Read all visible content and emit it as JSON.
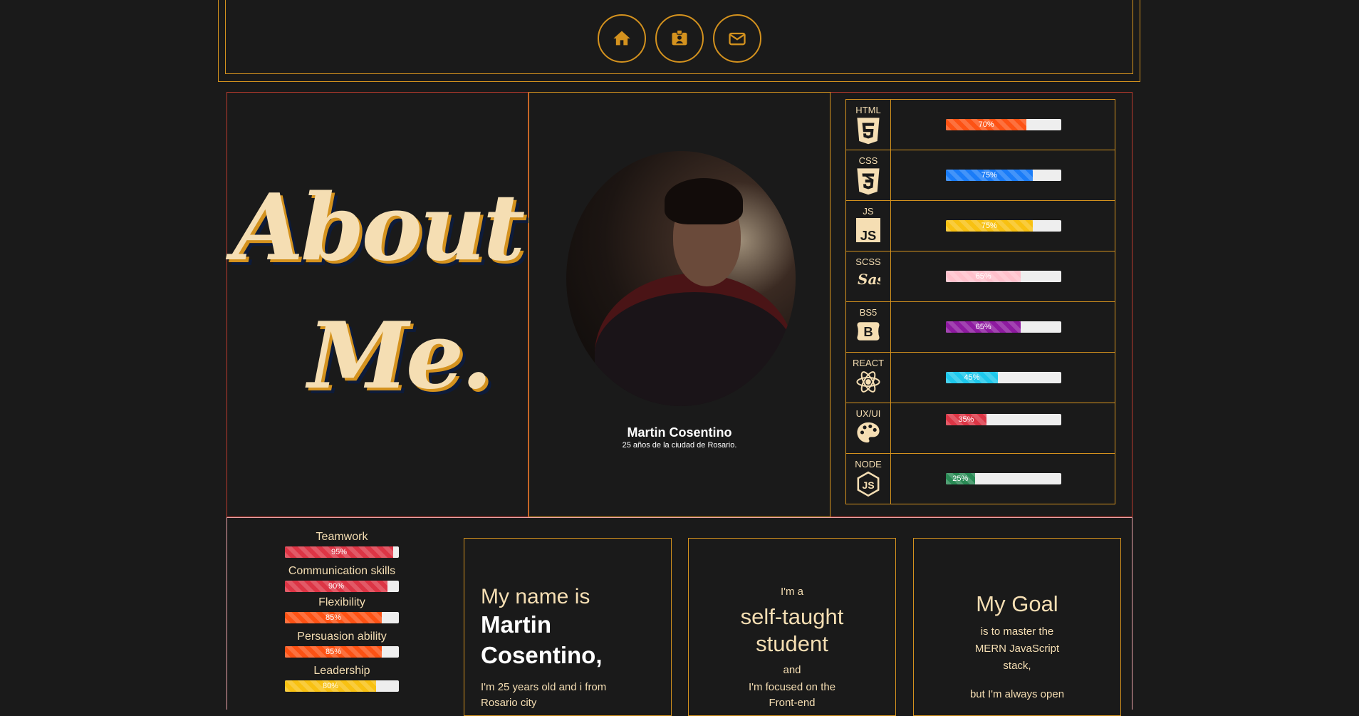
{
  "nav": {
    "home_icon": "home-icon",
    "id_icon": "id-badge-icon",
    "mail_icon": "envelope-icon"
  },
  "about": {
    "line1": "About",
    "line2": "Me."
  },
  "profile": {
    "name": "Martin Cosentino",
    "subtitle": "25 años de la ciudad de Rosario."
  },
  "skills": [
    {
      "label": "HTML",
      "icon": "html5-icon",
      "percent": 70,
      "text": "70%",
      "color": "#fd5214"
    },
    {
      "label": "CSS",
      "icon": "css3-icon",
      "percent": 75,
      "text": "75%",
      "color": "#1a7cf8"
    },
    {
      "label": "JS",
      "icon": "js-icon",
      "percent": 75,
      "text": "75%",
      "color": "#f8c112"
    },
    {
      "label": "SCSS",
      "icon": "sass-icon",
      "percent": 65,
      "text": "65%",
      "color": "#ffc0cb"
    },
    {
      "label": "BS5",
      "icon": "bootstrap-icon",
      "percent": 65,
      "text": "65%",
      "color": "#8e1aa0"
    },
    {
      "label": "REACT",
      "icon": "react-icon",
      "percent": 45,
      "text": "45%",
      "color": "#1ec8ec"
    },
    {
      "label": "UX/UI",
      "icon": "palette-icon",
      "percent": 35,
      "text": "35%",
      "color": "#dc3545"
    },
    {
      "label": "NODE",
      "icon": "nodejs-icon",
      "percent": 25,
      "text": "25%",
      "color": "#2a8a55"
    }
  ],
  "soft_skills": [
    {
      "label": "Teamwork",
      "percent": 95,
      "text": "95%",
      "color": "#dc3545"
    },
    {
      "label": "Communication skills",
      "percent": 90,
      "text": "90%",
      "color": "#dc3545"
    },
    {
      "label": "Flexibility",
      "percent": 85,
      "text": "85%",
      "color": "#fd5214"
    },
    {
      "label": "Persuasion ability",
      "percent": 85,
      "text": "85%",
      "color": "#fd5214"
    },
    {
      "label": "Leadership",
      "percent": 80,
      "text": "80%",
      "color": "#f8c112"
    }
  ],
  "cards": {
    "name_card": {
      "intro": "My name is",
      "name_line1": "Martin",
      "name_line2": "Cosentino,",
      "body1": "I'm 25 years old and i from",
      "body2": "Rosario city"
    },
    "student_card": {
      "pre": "I'm a",
      "title1": "self-taught",
      "title2": "student",
      "and": "and",
      "body1": "I'm focused on the",
      "body2": "Front-end"
    },
    "goal_card": {
      "title": "My Goal",
      "body1": "is to master the",
      "body2": "MERN JavaScript",
      "body3": "stack,",
      "body4": "but I'm always open"
    }
  }
}
